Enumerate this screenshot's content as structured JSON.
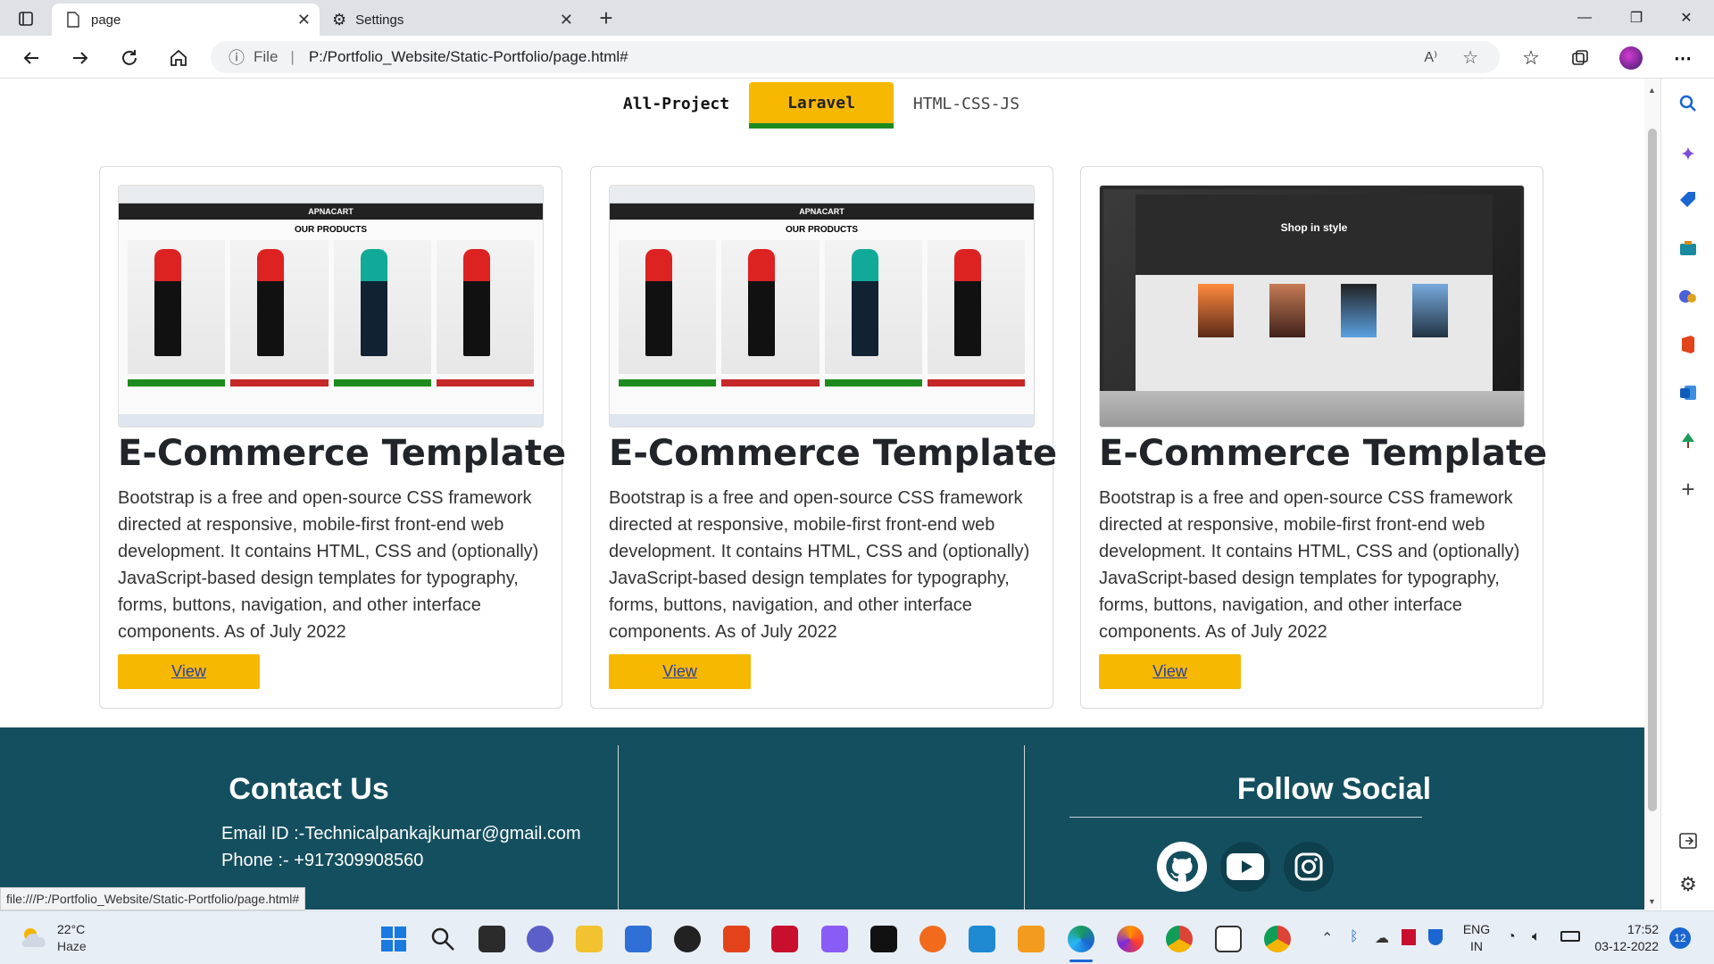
{
  "browser": {
    "tabs": [
      {
        "label": "page",
        "active": true
      },
      {
        "label": "Settings",
        "active": false
      }
    ],
    "address": {
      "file_label": "File",
      "url": "P:/Portfolio_Website/Static-Portfolio/page.html#"
    },
    "status_url": "file:///P:/Portfolio_Website/Static-Portfolio/page.html#"
  },
  "filters": {
    "items": [
      "All-Project",
      "Laravel",
      "HTML-CSS-JS"
    ],
    "active_index": 1,
    "accent": "#f6b800",
    "underline": "#1e8a1e"
  },
  "cards": [
    {
      "title": "E-Commerce Template",
      "desc": "Bootstrap is a free and open-source CSS framework directed at responsive, mobile-first front-end web development. It contains HTML, CSS and (optionally) JavaScript-based design templates for typography, forms, buttons, navigation, and other interface components. As of July 2022",
      "button": "View",
      "thumb": {
        "brand": "APNACART",
        "heading": "OUR PRODUCTS"
      }
    },
    {
      "title": "E-Commerce Template",
      "desc": "Bootstrap is a free and open-source CSS framework directed at responsive, mobile-first front-end web development. It contains HTML, CSS and (optionally) JavaScript-based design templates for typography, forms, buttons, navigation, and other interface components. As of July 2022",
      "button": "View",
      "thumb": {
        "brand": "APNACART",
        "heading": "OUR PRODUCTS"
      }
    },
    {
      "title": "E-Commerce Template",
      "desc": "Bootstrap is a free and open-source CSS framework directed at responsive, mobile-first front-end web development. It contains HTML, CSS and (optionally) JavaScript-based design templates for typography, forms, buttons, navigation, and other interface components. As of July 2022",
      "button": "View",
      "thumb": {
        "heading": "Shop in style"
      }
    }
  ],
  "footer": {
    "contact_title": "Contact Us",
    "email": "Email ID :-Technicalpankajkumar@gmail.com",
    "phone": "Phone :-  +917309908560",
    "social_title": "Follow Social",
    "social_icons": [
      "github-icon",
      "youtube-icon",
      "instagram-icon"
    ],
    "bg": "#144f5f"
  },
  "taskbar": {
    "weather_temp": "22°C",
    "weather_desc": "Haze",
    "lang": "ENG",
    "region": "IN",
    "time": "17:52",
    "date": "03-12-2022",
    "notifications": "12"
  }
}
